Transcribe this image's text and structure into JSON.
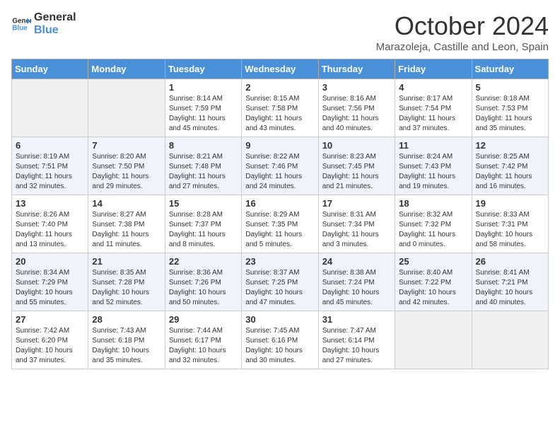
{
  "header": {
    "logo_line1": "General",
    "logo_line2": "Blue",
    "month": "October 2024",
    "location": "Marazoleja, Castille and Leon, Spain"
  },
  "days_of_week": [
    "Sunday",
    "Monday",
    "Tuesday",
    "Wednesday",
    "Thursday",
    "Friday",
    "Saturday"
  ],
  "weeks": [
    [
      {
        "day": "",
        "info": ""
      },
      {
        "day": "",
        "info": ""
      },
      {
        "day": "1",
        "info": "Sunrise: 8:14 AM\nSunset: 7:59 PM\nDaylight: 11 hours and 45 minutes."
      },
      {
        "day": "2",
        "info": "Sunrise: 8:15 AM\nSunset: 7:58 PM\nDaylight: 11 hours and 43 minutes."
      },
      {
        "day": "3",
        "info": "Sunrise: 8:16 AM\nSunset: 7:56 PM\nDaylight: 11 hours and 40 minutes."
      },
      {
        "day": "4",
        "info": "Sunrise: 8:17 AM\nSunset: 7:54 PM\nDaylight: 11 hours and 37 minutes."
      },
      {
        "day": "5",
        "info": "Sunrise: 8:18 AM\nSunset: 7:53 PM\nDaylight: 11 hours and 35 minutes."
      }
    ],
    [
      {
        "day": "6",
        "info": "Sunrise: 8:19 AM\nSunset: 7:51 PM\nDaylight: 11 hours and 32 minutes."
      },
      {
        "day": "7",
        "info": "Sunrise: 8:20 AM\nSunset: 7:50 PM\nDaylight: 11 hours and 29 minutes."
      },
      {
        "day": "8",
        "info": "Sunrise: 8:21 AM\nSunset: 7:48 PM\nDaylight: 11 hours and 27 minutes."
      },
      {
        "day": "9",
        "info": "Sunrise: 8:22 AM\nSunset: 7:46 PM\nDaylight: 11 hours and 24 minutes."
      },
      {
        "day": "10",
        "info": "Sunrise: 8:23 AM\nSunset: 7:45 PM\nDaylight: 11 hours and 21 minutes."
      },
      {
        "day": "11",
        "info": "Sunrise: 8:24 AM\nSunset: 7:43 PM\nDaylight: 11 hours and 19 minutes."
      },
      {
        "day": "12",
        "info": "Sunrise: 8:25 AM\nSunset: 7:42 PM\nDaylight: 11 hours and 16 minutes."
      }
    ],
    [
      {
        "day": "13",
        "info": "Sunrise: 8:26 AM\nSunset: 7:40 PM\nDaylight: 11 hours and 13 minutes."
      },
      {
        "day": "14",
        "info": "Sunrise: 8:27 AM\nSunset: 7:38 PM\nDaylight: 11 hours and 11 minutes."
      },
      {
        "day": "15",
        "info": "Sunrise: 8:28 AM\nSunset: 7:37 PM\nDaylight: 11 hours and 8 minutes."
      },
      {
        "day": "16",
        "info": "Sunrise: 8:29 AM\nSunset: 7:35 PM\nDaylight: 11 hours and 5 minutes."
      },
      {
        "day": "17",
        "info": "Sunrise: 8:31 AM\nSunset: 7:34 PM\nDaylight: 11 hours and 3 minutes."
      },
      {
        "day": "18",
        "info": "Sunrise: 8:32 AM\nSunset: 7:32 PM\nDaylight: 11 hours and 0 minutes."
      },
      {
        "day": "19",
        "info": "Sunrise: 8:33 AM\nSunset: 7:31 PM\nDaylight: 10 hours and 58 minutes."
      }
    ],
    [
      {
        "day": "20",
        "info": "Sunrise: 8:34 AM\nSunset: 7:29 PM\nDaylight: 10 hours and 55 minutes."
      },
      {
        "day": "21",
        "info": "Sunrise: 8:35 AM\nSunset: 7:28 PM\nDaylight: 10 hours and 52 minutes."
      },
      {
        "day": "22",
        "info": "Sunrise: 8:36 AM\nSunset: 7:26 PM\nDaylight: 10 hours and 50 minutes."
      },
      {
        "day": "23",
        "info": "Sunrise: 8:37 AM\nSunset: 7:25 PM\nDaylight: 10 hours and 47 minutes."
      },
      {
        "day": "24",
        "info": "Sunrise: 8:38 AM\nSunset: 7:24 PM\nDaylight: 10 hours and 45 minutes."
      },
      {
        "day": "25",
        "info": "Sunrise: 8:40 AM\nSunset: 7:22 PM\nDaylight: 10 hours and 42 minutes."
      },
      {
        "day": "26",
        "info": "Sunrise: 8:41 AM\nSunset: 7:21 PM\nDaylight: 10 hours and 40 minutes."
      }
    ],
    [
      {
        "day": "27",
        "info": "Sunrise: 7:42 AM\nSunset: 6:20 PM\nDaylight: 10 hours and 37 minutes."
      },
      {
        "day": "28",
        "info": "Sunrise: 7:43 AM\nSunset: 6:18 PM\nDaylight: 10 hours and 35 minutes."
      },
      {
        "day": "29",
        "info": "Sunrise: 7:44 AM\nSunset: 6:17 PM\nDaylight: 10 hours and 32 minutes."
      },
      {
        "day": "30",
        "info": "Sunrise: 7:45 AM\nSunset: 6:16 PM\nDaylight: 10 hours and 30 minutes."
      },
      {
        "day": "31",
        "info": "Sunrise: 7:47 AM\nSunset: 6:14 PM\nDaylight: 10 hours and 27 minutes."
      },
      {
        "day": "",
        "info": ""
      },
      {
        "day": "",
        "info": ""
      }
    ]
  ]
}
